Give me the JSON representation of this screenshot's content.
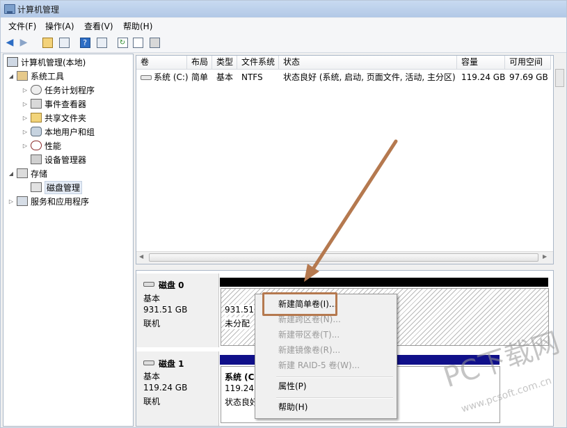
{
  "window": {
    "title": "计算机管理"
  },
  "menu": [
    "文件(F)",
    "操作(A)",
    "查看(V)",
    "帮助(H)"
  ],
  "tree": {
    "root": "计算机管理(本地)",
    "system_tools": "系统工具",
    "task_scheduler": "任务计划程序",
    "event_viewer": "事件查看器",
    "shared_folders": "共享文件夹",
    "local_users": "本地用户和组",
    "performance": "性能",
    "device_manager": "设备管理器",
    "storage": "存储",
    "disk_management": "磁盘管理",
    "services_apps": "服务和应用程序"
  },
  "volume_list": {
    "headers": [
      "卷",
      "布局",
      "类型",
      "文件系统",
      "状态",
      "容量",
      "可用空间"
    ],
    "rows": [
      {
        "volume": "系统 (C:)",
        "layout": "简单",
        "type": "基本",
        "fs": "NTFS",
        "status": "状态良好 (系统, 启动, 页面文件, 活动, 主分区)",
        "capacity": "119.24 GB",
        "free": "97.69 GB"
      }
    ]
  },
  "disks": [
    {
      "name": "磁盘 0",
      "type": "基本",
      "size": "931.51 GB",
      "state": "联机",
      "partition_size": "931.51",
      "partition_status": "未分配"
    },
    {
      "name": "磁盘 1",
      "type": "基本",
      "size": "119.24 GB",
      "state": "联机",
      "partition_name": "系统 (C",
      "partition_size": "119.24",
      "partition_status": "状态良好"
    }
  ],
  "context_menu": {
    "items": [
      {
        "label": "新建简单卷(I)...",
        "enabled": true
      },
      {
        "label": "新建跨区卷(N)...",
        "enabled": false
      },
      {
        "label": "新建带区卷(T)...",
        "enabled": false
      },
      {
        "label": "新建镜像卷(R)...",
        "enabled": false
      },
      {
        "label": "新建 RAID-5 卷(W)...",
        "enabled": false
      },
      {
        "label": "属性(P)",
        "enabled": true
      },
      {
        "label": "帮助(H)",
        "enabled": true
      }
    ]
  },
  "watermark": {
    "main": "PC下载网",
    "url": "www.pcsoft.com.cn"
  },
  "colors": {
    "annotation": "#b5794f",
    "disk_bar_unallocated": "#000000",
    "disk_bar_primary": "#10108a"
  }
}
